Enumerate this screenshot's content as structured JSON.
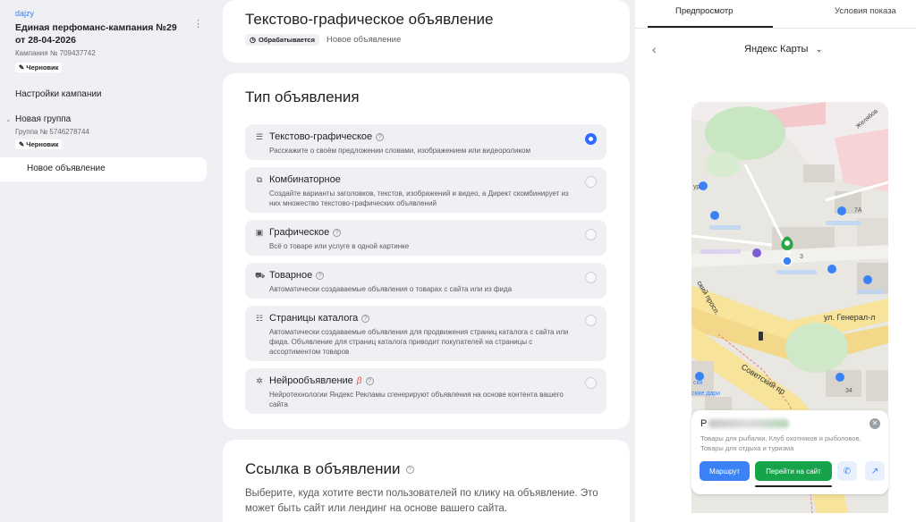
{
  "sidebar": {
    "user": "dajzy",
    "campaign_title": "Единая перфоманс-кампания №29 от 28-04-2026",
    "campaign_id": "Кампания № 709437742",
    "campaign_badge": "Черновик",
    "settings_link": "Настройки кампании",
    "group_title": "Новая группа",
    "group_id": "Группа № 5746278744",
    "group_badge": "Черновик",
    "ad_item": "Новое объявление"
  },
  "header": {
    "title": "Текстово-графическое объявление",
    "status_badge": "Обрабатывается",
    "status_label": "Новое объявление"
  },
  "ad_type": {
    "title": "Тип объявления",
    "options": [
      {
        "icon": "text-lines-icon",
        "title": "Текстово-графическое",
        "desc": "Расскажите о своём предложении словами, изображением или видеороликом",
        "selected": true
      },
      {
        "icon": "combinatorial-icon",
        "title": "Комбинаторное",
        "desc": "Создайте варианты заголовков, текстов, изображений и видео, а Директ скомбинирует из них множество текстово-графических объявлений",
        "selected": false
      },
      {
        "icon": "image-icon",
        "title": "Графическое",
        "desc": "Всё о товаре или услуге в одной картинке",
        "selected": false
      },
      {
        "icon": "cart-icon",
        "title": "Товарное",
        "desc": "Автоматически создаваемые объявления о товарах с сайта или из фида",
        "selected": false
      },
      {
        "icon": "catalog-icon",
        "title": "Страницы каталога",
        "desc": "Автоматически создаваемые объявления для продвижения страниц каталога с сайта или фида. Объявление для страниц каталога приводит покупателей на страницы с ассортиментом товаров",
        "selected": false
      },
      {
        "icon": "neuro-icon",
        "title": "Нейрообъявление",
        "beta": "β",
        "desc": "Нейротехнологии Яндекс Рекламы сгенерируют объявления на основе контента вашего сайта",
        "selected": false
      }
    ]
  },
  "link_section": {
    "title": "Ссылка в объявлении",
    "desc": "Выберите, куда хотите вести пользователей по клику на объявление. Это может быть сайт или лендинг на основе вашего сайта."
  },
  "preview": {
    "tab_preview": "Предпросмотр",
    "tab_conditions": "Условия показа",
    "device": "Яндекс Карты",
    "map": {
      "street_1": "ул. Генерал-л",
      "street_2": "Советский пр",
      "street_3": "ский просп.",
      "street_4": "Желябов",
      "label_ur": "ур.",
      "num_7a": "7А",
      "num_3": "3",
      "num_34": "34",
      "label_ski": "ски",
      "label_dari": "ские дари"
    },
    "card": {
      "name_initial": "Р",
      "desc": "Товары для рыбалки, Клуб охотников и рыболовов, Товары для отдыха и туризма",
      "route_btn": "Маршрут",
      "site_btn": "Перейти на сайт"
    }
  },
  "colors": {
    "accent": "#2f6bff",
    "site_button": "#16a34a",
    "route_button": "#3b82f6"
  }
}
